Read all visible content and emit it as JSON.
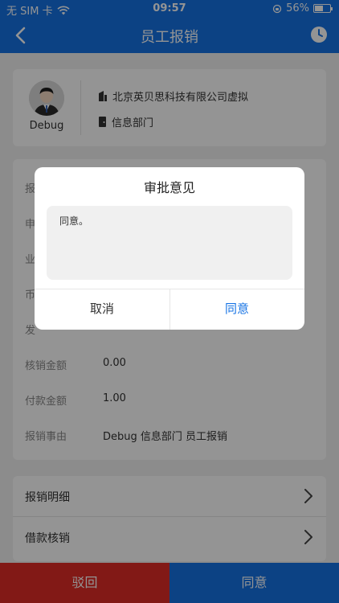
{
  "status": {
    "carrier": "无 SIM 卡",
    "time": "09:57",
    "battery": "56%",
    "battery_level": 0.56
  },
  "nav": {
    "title": "员工报销",
    "back_icon": "chevron-left-icon",
    "right_icon": "history-clock-icon"
  },
  "user": {
    "name": "Debug",
    "company": "北京英贝思科技有限公司虚拟",
    "department": "信息部门"
  },
  "info": {
    "rows": [
      {
        "label": "报",
        "value": ""
      },
      {
        "label": "申",
        "value": ""
      },
      {
        "label": "业",
        "value": ""
      },
      {
        "label": "币",
        "value": ""
      },
      {
        "label": "发",
        "value": ""
      },
      {
        "label": "核销金额",
        "value": "0.00"
      },
      {
        "label": "付款金额",
        "value": "1.00"
      },
      {
        "label": "报销事由",
        "value": "Debug 信息部门 员工报销"
      }
    ]
  },
  "list": {
    "detail_label": "报销明细",
    "loan_label": "借款核销"
  },
  "bottom": {
    "reject_label": "驳回",
    "approve_label": "同意"
  },
  "dialog": {
    "title": "审批意见",
    "comment": "同意。",
    "cancel_label": "取消",
    "confirm_label": "同意"
  },
  "colors": {
    "brand_blue": "#1673e4",
    "reject_red": "#e02c26"
  }
}
